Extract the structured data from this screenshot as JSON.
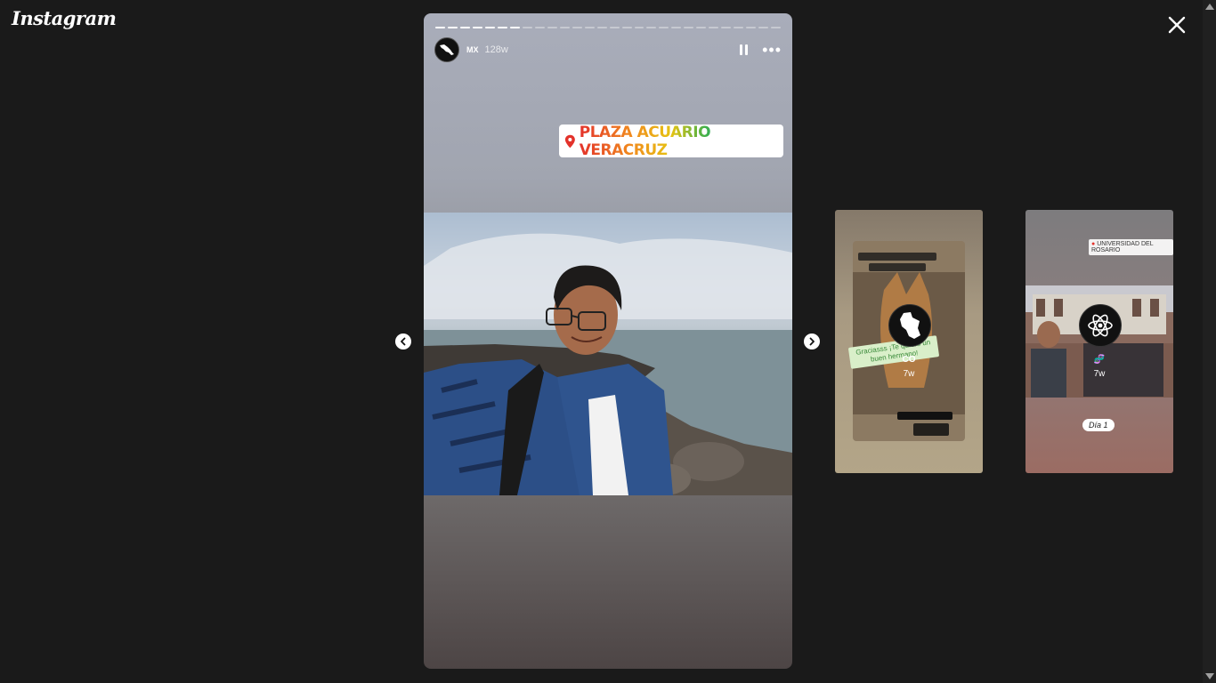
{
  "app": {
    "logo_text": "Instagram"
  },
  "story": {
    "username": "MX",
    "age": "128w",
    "progress": {
      "total_segments": 28,
      "completed_segments": 7
    },
    "location_sticker": "PLAZA ACUARIO VERACRUZ"
  },
  "previews": [
    {
      "username": "CO",
      "age": "7w",
      "note_text": "Graciasss ¡Te quiero un buen hermano!"
    },
    {
      "username": "🧬",
      "age": "7w",
      "location_text": "UNIVERSIDAD DEL ROSARIO",
      "caption": "Día 1"
    }
  ],
  "colors": {
    "background": "#1a1a1a",
    "icon": "#ffffff"
  },
  "icons": {
    "close": "close-icon",
    "pause": "pause-icon",
    "more": "more-options-icon",
    "prev": "chevron-left-icon",
    "next": "chevron-right-icon",
    "location": "location-pin-icon"
  }
}
